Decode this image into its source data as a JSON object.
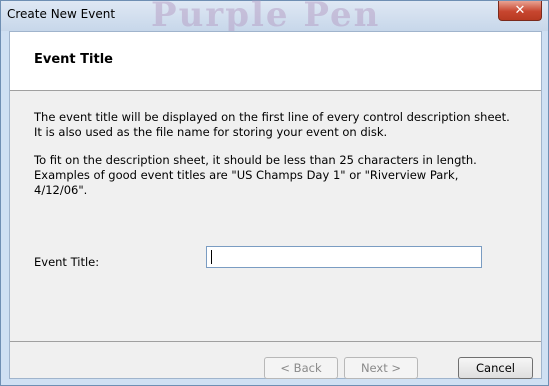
{
  "window": {
    "title": "Create New Event",
    "background_watermark": "Purple Pen",
    "close_glyph": "✕"
  },
  "header": {
    "heading": "Event Title"
  },
  "body": {
    "paragraph_1": "The event title will be displayed on the first line of every control description sheet. It is also used as the file name for storing your event on disk.",
    "paragraph_2": "To fit on the description sheet, it should be less than 25 characters in length. Examples of good event titles are \"US Champs Day 1\" or \"Riverview Park, 4/12/06\"."
  },
  "form": {
    "event_title_label": "Event Title:",
    "event_title_value": ""
  },
  "buttons": {
    "back": "< Back",
    "next": "Next >",
    "cancel": "Cancel"
  },
  "colors": {
    "close_button": "#c7462f",
    "frame": "#cfe0f3",
    "client_bg": "#f0f0f0"
  }
}
